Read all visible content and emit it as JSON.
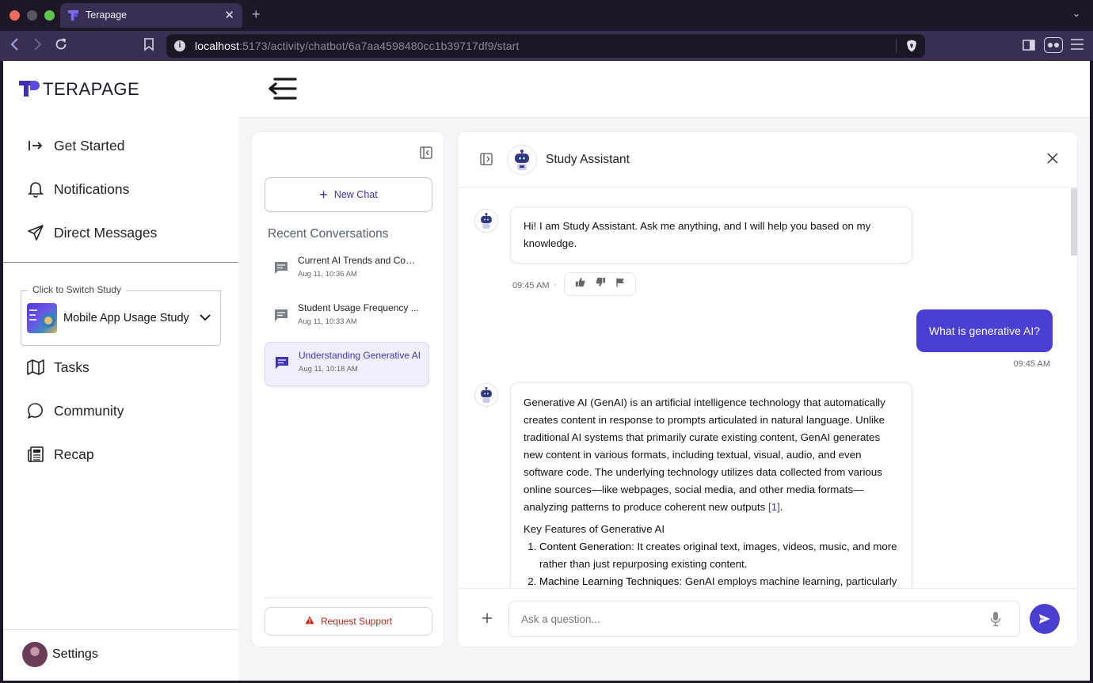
{
  "browser": {
    "tab_title": "Terapage",
    "url_host": "localhost",
    "url_path": ":5173/activity/chatbot/6a7aa4598480cc1b39717df9/start"
  },
  "sidebar": {
    "logo_text": "TERAPAGE",
    "items": [
      {
        "label": "Get Started",
        "icon": "arrow-right-to-bar-icon"
      },
      {
        "label": "Notifications",
        "icon": "bell-icon"
      },
      {
        "label": "Direct Messages",
        "icon": "send-icon"
      }
    ],
    "study_switch": {
      "legend": "Click to Switch Study",
      "selected": "Mobile App Usage Study"
    },
    "items2": [
      {
        "label": "Tasks",
        "icon": "map-icon"
      },
      {
        "label": "Community",
        "icon": "chat-bubble-icon"
      },
      {
        "label": "Recap",
        "icon": "newspaper-icon"
      }
    ],
    "settings_label": "Settings"
  },
  "conversations": {
    "new_chat_label": "New Chat",
    "recent_title": "Recent Conversations",
    "items": [
      {
        "title": "Current AI Trends and Com...",
        "date": "Aug 11, 10:36 AM",
        "active": false
      },
      {
        "title": "Student Usage Frequency ...",
        "date": "Aug 11, 10:33 AM",
        "active": false
      },
      {
        "title": "Understanding Generative AI",
        "date": "Aug 11, 10:18 AM",
        "active": true
      }
    ],
    "support_label": "Request Support"
  },
  "chat": {
    "title": "Study Assistant",
    "messages": {
      "greeting": "Hi! I am Study Assistant. Ask me anything, and I will help you based on my knowledge.",
      "greeting_time": "09:45 AM",
      "meta_dot": "·",
      "user_question": "What is generative AI?",
      "user_time": "09:45 AM",
      "answer_paragraph": "Generative AI (GenAI) is an artificial intelligence technology that automatically creates content in response to prompts articulated in natural language. Unlike traditional AI systems that primarily curate existing content, GenAI generates new content in various formats, including textual, visual, audio, and even software code. The underlying technology utilizes data collected from various online sources—like webpages, social media, and other media formats—analyzing patterns to produce coherent new outputs",
      "answer_citation": "[1]",
      "answer_heading": "Key Features of Generative AI",
      "features": [
        {
          "term": "Content Generation",
          "text": ": It creates original text, images, videos, music, and more rather than just repurposing existing content."
        },
        {
          "term": "Machine Learning Techniques",
          "text": ": GenAI employs machine learning, particularly"
        }
      ]
    },
    "input_placeholder": "Ask a question..."
  },
  "colors": {
    "accent": "#4a3fd0",
    "support_red": "#b22a1e",
    "active_conv_bg": "#efeefb"
  }
}
